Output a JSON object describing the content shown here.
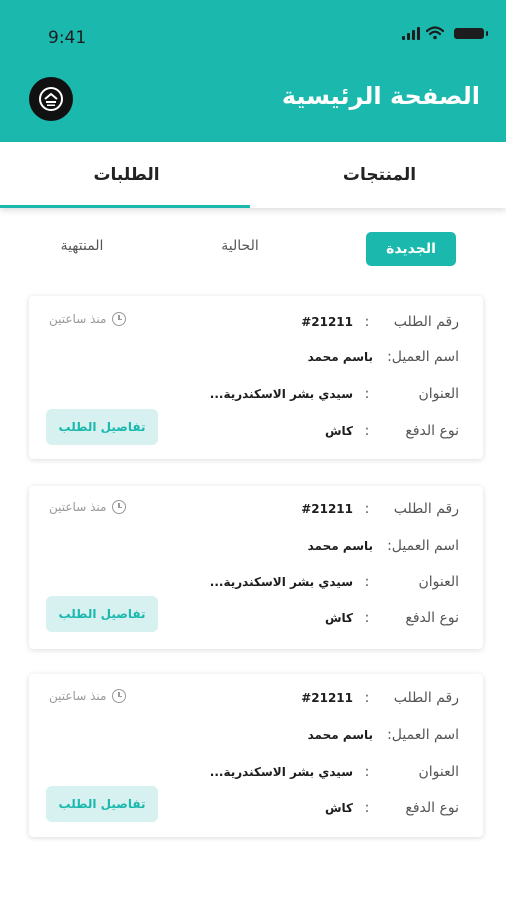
{
  "status_bar": {
    "time": "9:41"
  },
  "header": {
    "title": "الصفحة الرئيسية",
    "logo_icon": "logo-icon",
    "background": "#1bb8ae"
  },
  "tabs": [
    {
      "label": "المنتجات",
      "active": false
    },
    {
      "label": "الطلبات",
      "active": true
    }
  ],
  "filters": [
    {
      "label": "الجديدة",
      "active": true
    },
    {
      "label": "الحالية",
      "active": false
    },
    {
      "label": "المنتهية",
      "active": false
    }
  ],
  "field_labels": {
    "order_number": "رقم الطلب",
    "customer_name": "اسم العميل:",
    "address": "العنوان",
    "payment_type": "نوع الدفع",
    "colon": ":"
  },
  "orders": [
    {
      "order_number": "#21211",
      "customer_name": "باسم محمد",
      "address": "سيدي بشر الاسكندرية...",
      "payment_type": "كاش",
      "time_ago": "منذ ساعتين",
      "details_label": "تفاصيل الطلب"
    },
    {
      "order_number": "#21211",
      "customer_name": "باسم محمد",
      "address": "سيدي بشر الاسكندرية...",
      "payment_type": "كاش",
      "time_ago": "منذ ساعتين",
      "details_label": "تفاصيل الطلب"
    },
    {
      "order_number": "#21211",
      "customer_name": "باسم محمد",
      "address": "سيدي بشر الاسكندرية...",
      "payment_type": "كاش",
      "time_ago": "منذ ساعتين",
      "details_label": "تفاصيل الطلب"
    }
  ],
  "colors": {
    "accent": "#1bb8ae",
    "accent_light": "#d6f1ef"
  }
}
